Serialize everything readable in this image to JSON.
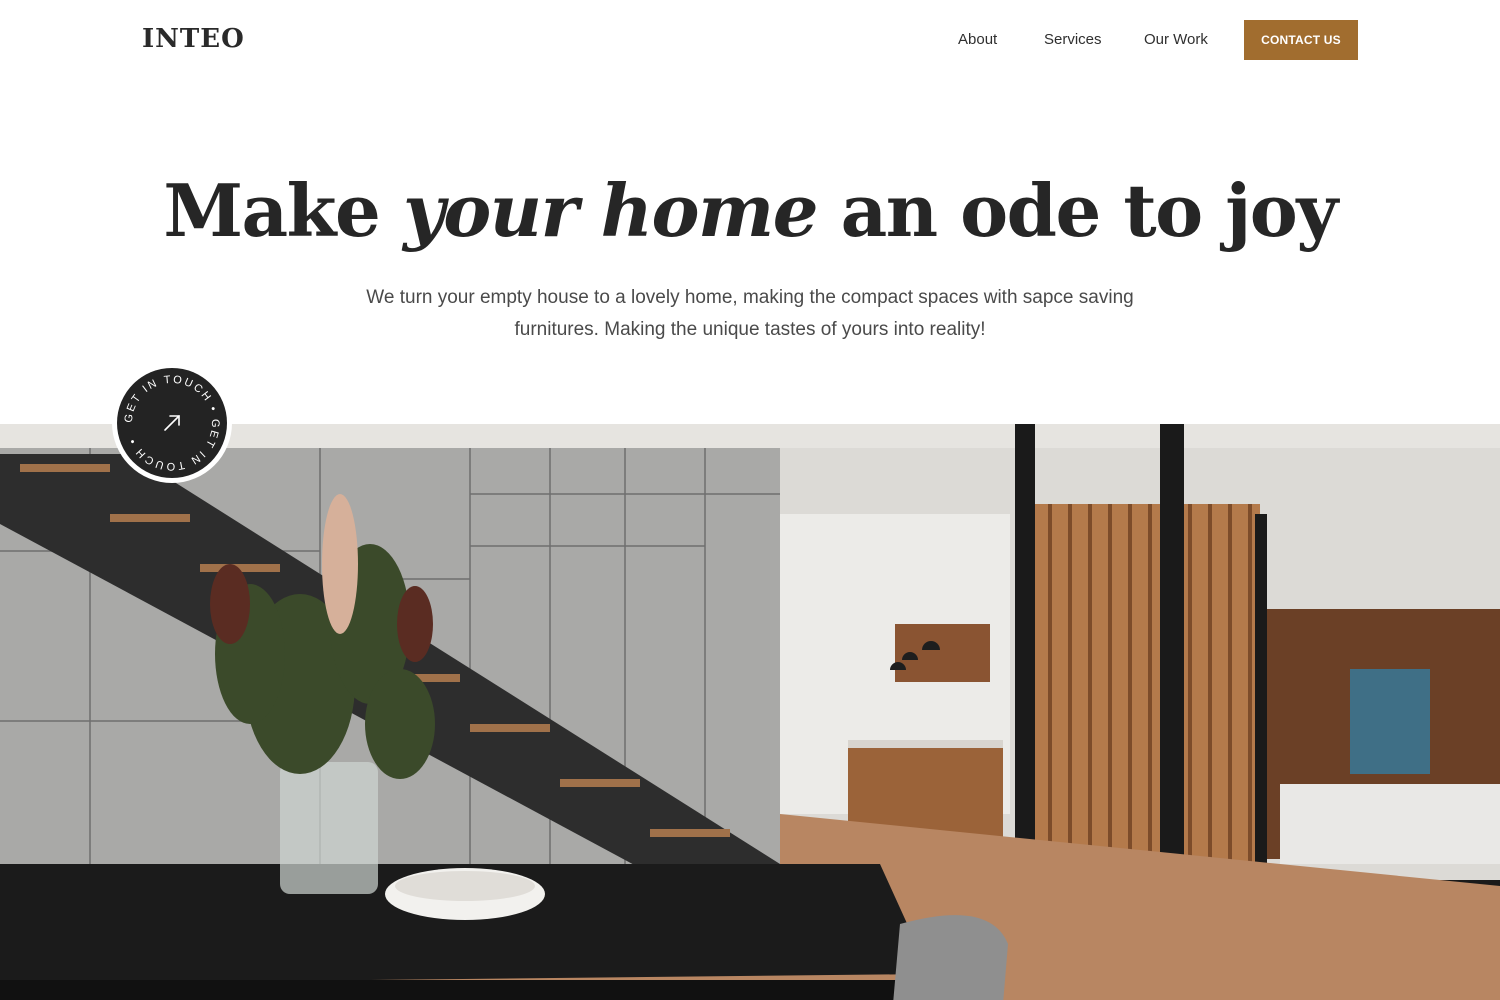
{
  "header": {
    "logo_text": "INTEO",
    "nav": [
      {
        "label": "About"
      },
      {
        "label": "Services"
      },
      {
        "label": "Our Work"
      }
    ],
    "cta_label": "CONTACT US"
  },
  "hero": {
    "title_part1": "Make",
    "title_italic": "your home",
    "title_part2": "an ode to joy",
    "subtitle_line1": "We turn your empty house to a lovely home, making the compact spaces with sapce saving",
    "subtitle_line2": "furnitures. Making the unique tastes of yours into reality!"
  },
  "badge": {
    "text": "GET IN TOUCH • GET IN TOUCH •",
    "icon": "arrow-up-right-icon"
  },
  "image": {
    "icon": "interior-photo"
  },
  "colors": {
    "accent": "#a16d2f",
    "text_dark": "#262626",
    "badge_bg": "#232323"
  }
}
